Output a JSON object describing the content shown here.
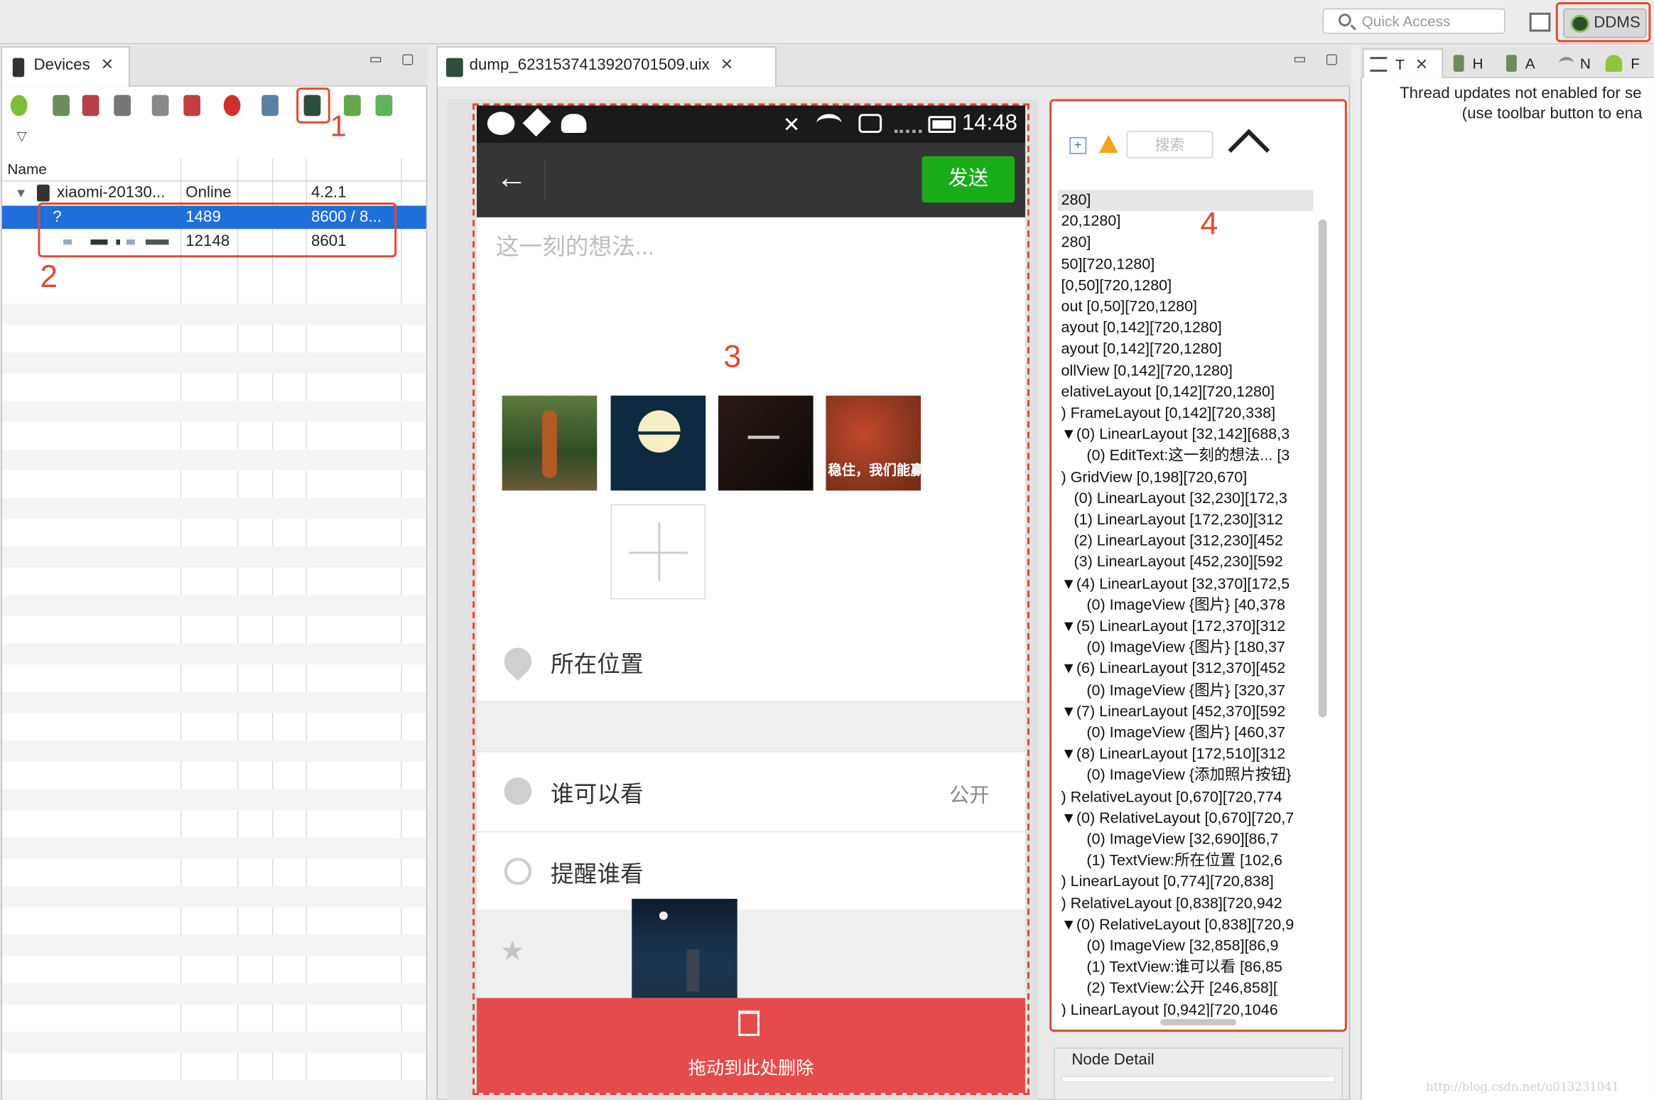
{
  "topbar": {
    "quick_access_placeholder": "Quick Access",
    "perspective_label": "DDMS"
  },
  "devices": {
    "tab_label": "Devices",
    "column_name": "Name",
    "rows": [
      {
        "name": "xiaomi-20130...",
        "status": "Online",
        "version": "4.2.1"
      },
      {
        "name": "?",
        "pid": "1489",
        "port": "8600 / 8..."
      },
      {
        "name": "",
        "pid": "12148",
        "port": "8601"
      }
    ]
  },
  "dump": {
    "tab_label": "dump_6231537413920701509.uix"
  },
  "phone": {
    "time": "14:48",
    "send_label": "发送",
    "compose_placeholder": "这一刻的想法...",
    "thumb_caption": "稳住，我们能赢",
    "location_label": "所在位置",
    "who_can_see_label": "谁可以看",
    "who_can_see_value": "公开",
    "remind_label": "提醒谁看",
    "delete_label": "拖动到此处删除"
  },
  "tree": {
    "search_placeholder": "搜索",
    "lines": [
      "280]",
      "20,1280]",
      "280]",
      "50][720,1280]",
      "[0,50][720,1280]",
      "out [0,50][720,1280]",
      "ayout [0,142][720,1280]",
      "ayout [0,142][720,1280]",
      "ollView [0,142][720,1280]",
      "elativeLayout [0,142][720,1280]",
      ") FrameLayout [0,142][720,338]",
      "▼(0) LinearLayout [32,142][688,3",
      "      (0) EditText:这一刻的想法... [3",
      ") GridView [0,198][720,670]",
      "   (0) LinearLayout [32,230][172,3",
      "   (1) LinearLayout [172,230][312",
      "   (2) LinearLayout [312,230][452",
      "   (3) LinearLayout [452,230][592",
      "▼(4) LinearLayout [32,370][172,5",
      "      (0) ImageView {图片} [40,378",
      "▼(5) LinearLayout [172,370][312",
      "      (0) ImageView {图片} [180,37",
      "▼(6) LinearLayout [312,370][452",
      "      (0) ImageView {图片} [320,37",
      "▼(7) LinearLayout [452,370][592",
      "      (0) ImageView {图片} [460,37",
      "▼(8) LinearLayout [172,510][312",
      "      (0) ImageView {添加照片按钮}",
      ") RelativeLayout [0,670][720,774",
      "▼(0) RelativeLayout [0,670][720,7",
      "      (0) ImageView [32,690][86,7",
      "      (1) TextView:所在位置 [102,6",
      ") LinearLayout [0,774][720,838]",
      ") RelativeLayout [0,838][720,942",
      "▼(0) RelativeLayout [0,838][720,9",
      "      (0) ImageView [32,858][86,9",
      "      (1) TextView:谁可以看 [86,85",
      "      (2) TextView:公开 [246,858][",
      ") LinearLayout [0,942][720,1046"
    ],
    "node_detail_label": "Node Detail"
  },
  "right_panel": {
    "tabs": [
      "T",
      "H",
      "A",
      "N",
      "F"
    ],
    "message_line1": "Thread updates not enabled for se",
    "message_line2": "(use toolbar button to ena"
  },
  "annotations": {
    "n1": "1",
    "n2": "2",
    "n3": "3",
    "n4": "4"
  },
  "watermark": "http://blog.csdn.net/u013231041",
  "colors": {
    "annotation_red": "#e04a2f",
    "selection_blue": "#1e6fd9",
    "wechat_green": "#1aad19",
    "delete_red": "#e64b4b"
  }
}
